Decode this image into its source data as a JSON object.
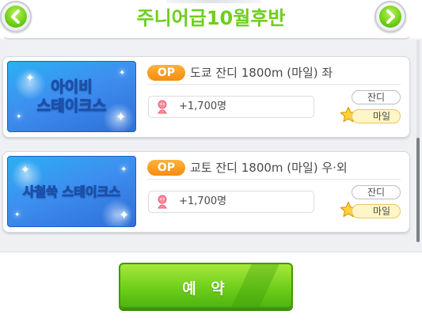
{
  "header": {
    "title": "주니어급10월후반",
    "prev_icon": "chevron-left-icon",
    "next_icon": "chevron-right-icon"
  },
  "races": [
    {
      "banner_lines": [
        "아이비",
        "스테이크스"
      ],
      "grade": "OP",
      "name": "도쿄 잔디 1800m (마일) 좌",
      "fans": "+1,700명",
      "surface": "잔디",
      "distance": "마일"
    },
    {
      "banner_lines": [
        "사철쑥 스테이크스"
      ],
      "grade": "OP",
      "name": "교토 잔디 1800m (마일) 우·외",
      "fans": "+1,700명",
      "surface": "잔디",
      "distance": "마일"
    }
  ],
  "footer": {
    "reserve_label": "예 약"
  },
  "colors": {
    "accent_green": "#6ccf1c",
    "grade_orange": "#f58c10",
    "banner_blue": "#3d8ff0"
  }
}
